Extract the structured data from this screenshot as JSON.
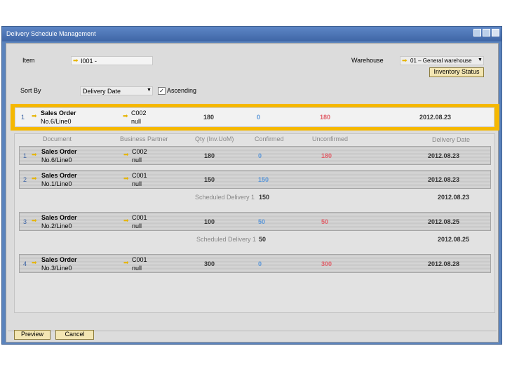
{
  "window": {
    "title": "Delivery Schedule Management"
  },
  "item": {
    "label": "Item",
    "value": "I001 -"
  },
  "warehouse": {
    "label": "Warehouse",
    "value": "01 – General warehouse",
    "status_button": "Inventory Status"
  },
  "sort": {
    "label": "Sort By",
    "value": "Delivery Date",
    "ascending_label": "Ascending",
    "ascending_checked": true
  },
  "selected": {
    "num": "1",
    "doc": "Sales Order",
    "doc2": "No.6/Line0",
    "bp": "C002",
    "bp2": "null",
    "qty": "180",
    "confirmed": "0",
    "unconfirmed": "180",
    "date": "2012.08.23"
  },
  "columns": {
    "document": "Document",
    "bp": "Business Partner",
    "qty": "Qty (Inv.UoM)",
    "confirmed": "Confirmed",
    "unconfirmed": "Unconfirmed",
    "date": "Delivery Date"
  },
  "rows": [
    {
      "num": "1",
      "doc": "Sales Order",
      "doc2": "No.6/Line0",
      "bp": "C002",
      "bp2": "null",
      "qty": "180",
      "confirmed": "0",
      "unconfirmed": "180",
      "date": "2012.08.23"
    },
    {
      "num": "2",
      "doc": "Sales Order",
      "doc2": "No.1/Line0",
      "bp": "C001",
      "bp2": "null",
      "qty": "150",
      "confirmed": "150",
      "unconfirmed": "",
      "date": "2012.08.23",
      "sched_label": "Scheduled Delivery 1",
      "sched_qty": "150",
      "sched_date": "2012.08.23"
    },
    {
      "num": "3",
      "doc": "Sales Order",
      "doc2": "No.2/Line0",
      "bp": "C001",
      "bp2": "null",
      "qty": "100",
      "confirmed": "50",
      "unconfirmed": "50",
      "date": "2012.08.25",
      "sched_label": "Scheduled Delivery 1",
      "sched_qty": "50",
      "sched_date": "2012.08.25"
    },
    {
      "num": "4",
      "doc": "Sales Order",
      "doc2": "No.3/Line0",
      "bp": "C001",
      "bp2": "null",
      "qty": "300",
      "confirmed": "0",
      "unconfirmed": "300",
      "date": "2012.08.28"
    }
  ],
  "buttons": {
    "preview": "Preview",
    "cancel": "Cancel"
  },
  "colors": {
    "title_bar": "#4a72b2",
    "highlight": "#f5b800",
    "confirmed": "#5c97d8",
    "unconfirmed": "#e0606a"
  }
}
